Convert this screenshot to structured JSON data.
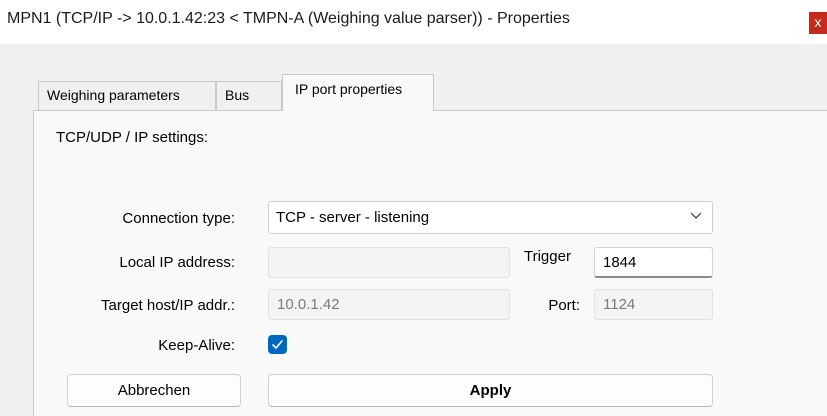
{
  "window": {
    "title": "MPN1 (TCP/IP -> 10.0.1.42:23 < TMPN-A (Weighing value parser)) - Properties",
    "close_glyph": "x"
  },
  "tabs": [
    {
      "label": "Weighing parameters",
      "active": false
    },
    {
      "label": "Bus",
      "active": false
    },
    {
      "label": "IP port properties",
      "active": true
    }
  ],
  "section": {
    "heading": "TCP/UDP / IP settings:"
  },
  "form": {
    "connection_type_label": "Connection type:",
    "connection_type_value": "TCP - server - listening",
    "local_ip_label": "Local IP address:",
    "local_ip_value": "",
    "trigger_label": "Trigger",
    "trigger_value": "1844",
    "target_host_label": "Target host/IP addr.:",
    "target_host_value": "10.0.1.42",
    "port_label": "Port:",
    "port_value": "1124",
    "keep_alive_label": "Keep-Alive:",
    "keep_alive_checked": true
  },
  "buttons": {
    "cancel_label": "Abbrechen",
    "apply_label": "Apply"
  },
  "colors": {
    "accent": "#0067c0",
    "close": "#c42b1c"
  },
  "icons": {
    "dropdown": "chevron-down-icon",
    "check": "checkmark-icon"
  }
}
